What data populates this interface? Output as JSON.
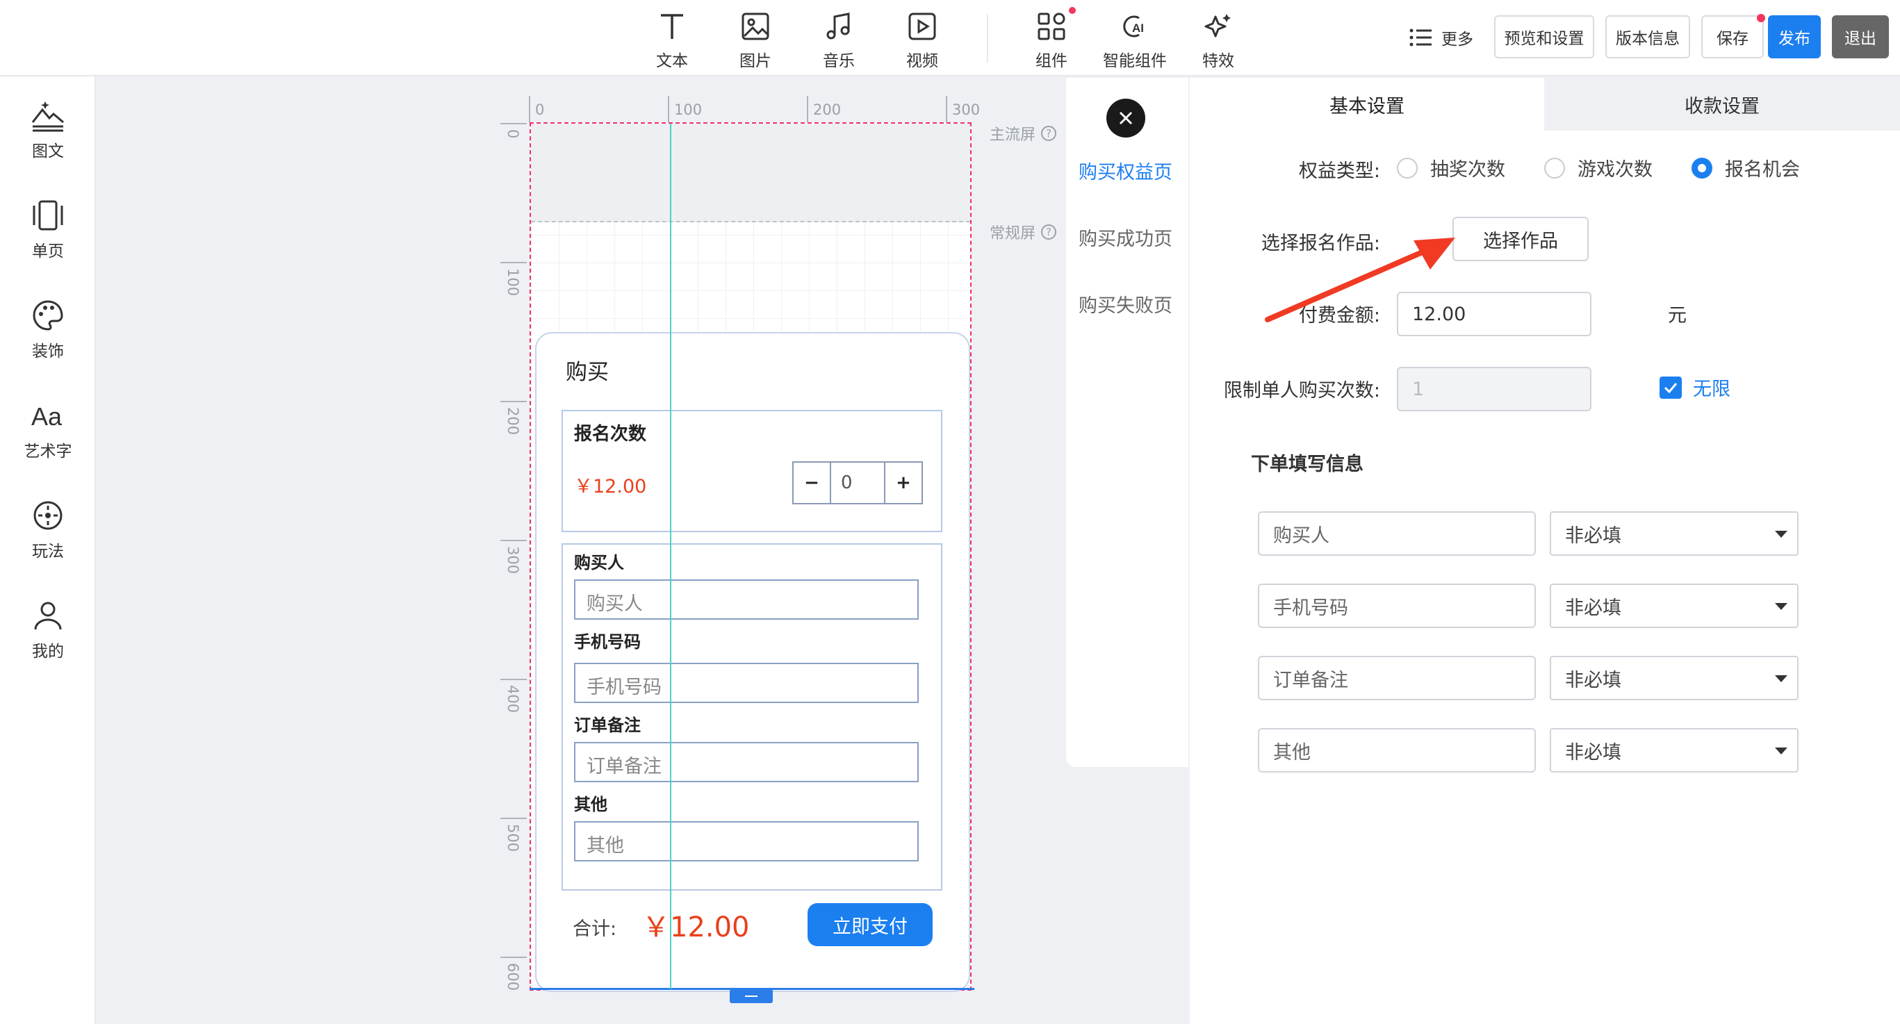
{
  "toolbar": {
    "tools": [
      {
        "label": "文本",
        "icon": "text-icon"
      },
      {
        "label": "图片",
        "icon": "image-icon"
      },
      {
        "label": "音乐",
        "icon": "music-icon"
      },
      {
        "label": "视频",
        "icon": "video-icon"
      },
      {
        "label": "组件",
        "icon": "components-icon"
      },
      {
        "label": "智能组件",
        "icon": "ai-icon"
      },
      {
        "label": "特效",
        "icon": "sparkle-icon"
      }
    ],
    "more_label": "更多",
    "preview_label": "预览和设置",
    "version_label": "版本信息",
    "save_label": "保存",
    "publish_label": "发布",
    "exit_label": "退出"
  },
  "sidebar": {
    "items": [
      {
        "label": "图文",
        "icon": "graphic-text-icon"
      },
      {
        "label": "单页",
        "icon": "single-page-icon"
      },
      {
        "label": "装饰",
        "icon": "palette-icon"
      },
      {
        "label": "艺术字",
        "icon": "art-text-icon"
      },
      {
        "label": "玩法",
        "icon": "gameplay-icon"
      },
      {
        "label": "我的",
        "icon": "user-icon"
      }
    ]
  },
  "canvas": {
    "ruler_x": [
      "0",
      "100",
      "200",
      "300"
    ],
    "ruler_y": [
      "0",
      "100",
      "200",
      "300",
      "400",
      "500",
      "600"
    ],
    "main_screen_label": "主流屏",
    "normal_screen_label": "常规屏",
    "card": {
      "title": "购买",
      "item_name": "报名次数",
      "item_price": "￥12.00",
      "quantity": "0",
      "minus": "−",
      "plus": "+",
      "fields": [
        {
          "label": "购买人",
          "placeholder": "购买人"
        },
        {
          "label": "手机号码",
          "placeholder": "手机号码"
        },
        {
          "label": "订单备注",
          "placeholder": "订单备注"
        },
        {
          "label": "其他",
          "placeholder": "其他"
        }
      ],
      "total_label": "合计:",
      "total_value": "￥12.00",
      "pay_label": "立即支付"
    }
  },
  "pages": {
    "items": [
      "购买权益页",
      "购买成功页",
      "购买失败页"
    ],
    "active_index": 0
  },
  "settings": {
    "tabs": [
      "基本设置",
      "收款设置"
    ],
    "benefit_type_label": "权益类型:",
    "benefit_options": [
      {
        "label": "抽奖次数",
        "checked": false
      },
      {
        "label": "游戏次数",
        "checked": false
      },
      {
        "label": "报名机会",
        "checked": true
      }
    ],
    "select_work_label": "选择报名作品:",
    "select_work_button": "选择作品",
    "pay_amount_label": "付费金额:",
    "pay_amount_value": "12.00",
    "currency_unit": "元",
    "limit_label": "限制单人购买次数:",
    "limit_value": "1",
    "unlimited_label": "无限",
    "unlimited_checked": true,
    "order_info_title": "下单填写信息",
    "order_fields": [
      {
        "name": "购买人",
        "requirement": "非必填"
      },
      {
        "name": "手机号码",
        "requirement": "非必填"
      },
      {
        "name": "订单备注",
        "requirement": "非必填"
      },
      {
        "name": "其他",
        "requirement": "非必填"
      }
    ]
  },
  "colors": {
    "accent": "#1c7ff0",
    "price_red": "#e8401c",
    "notify_dot": "#f2365b",
    "guide_line": "#4fd1c5",
    "annotation_arrow": "#f03a24"
  }
}
